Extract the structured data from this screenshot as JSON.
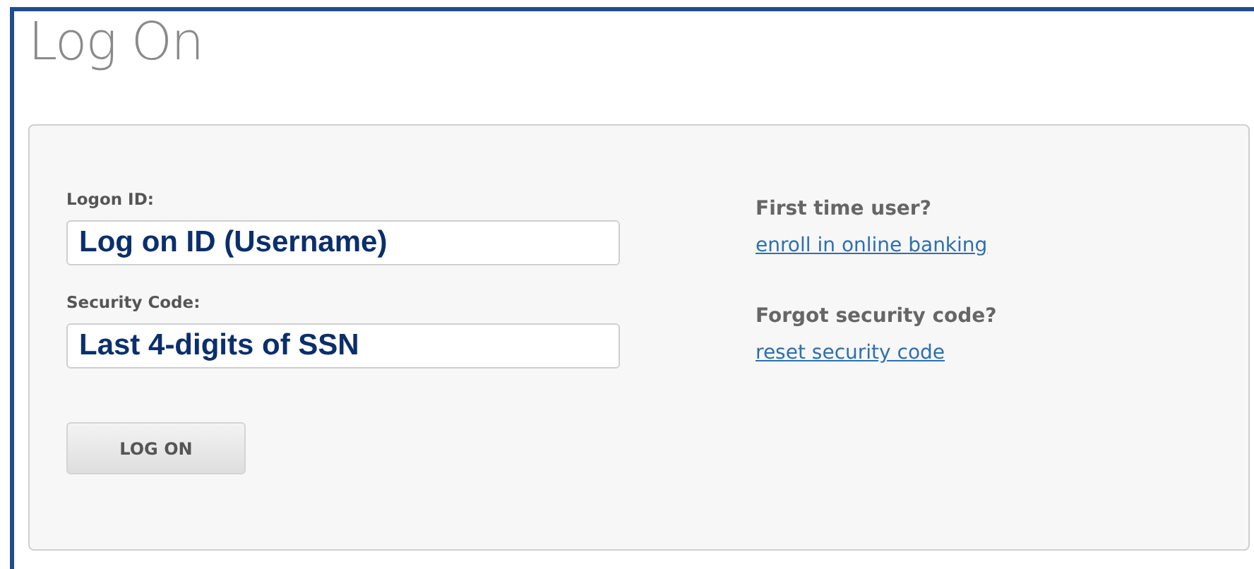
{
  "title": "Log On",
  "fields": [
    {
      "label": "Logon ID:",
      "value": "Log on ID (Username)"
    },
    {
      "label": "Security Code:",
      "value": "Last 4-digits of SSN"
    }
  ],
  "button": "LOG ON",
  "help": [
    {
      "question": "First time user?",
      "link": "enroll in online banking"
    },
    {
      "question": "Forgot security code?",
      "link": "reset security code"
    }
  ]
}
